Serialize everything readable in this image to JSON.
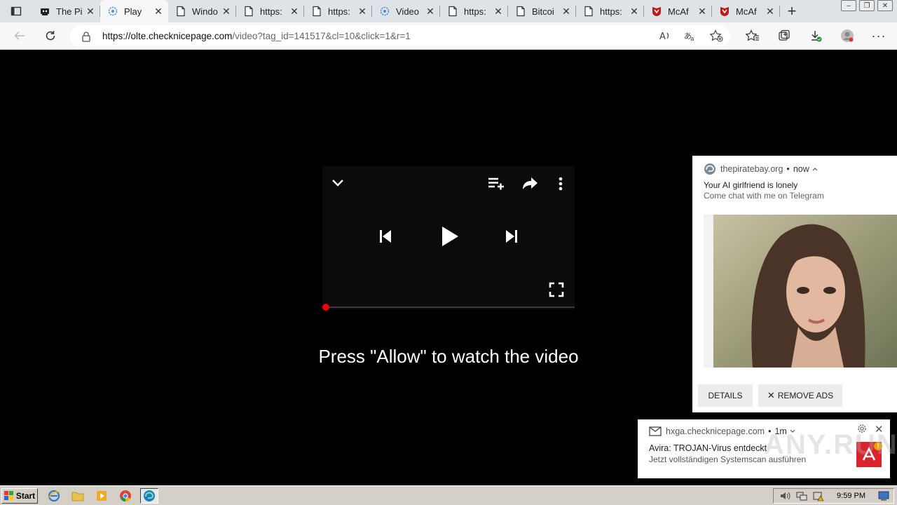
{
  "browser": {
    "tabs": [
      {
        "title": "The Pi",
        "icon": "robot-icon",
        "active": false
      },
      {
        "title": "Play",
        "icon": "gear-cloud-icon",
        "active": true
      },
      {
        "title": "Windo",
        "icon": "page-icon",
        "active": false
      },
      {
        "title": "https:",
        "icon": "page-icon",
        "active": false
      },
      {
        "title": "https:",
        "icon": "page-icon",
        "active": false
      },
      {
        "title": "Video",
        "icon": "gear-cloud-icon",
        "active": false
      },
      {
        "title": "https:",
        "icon": "page-icon",
        "active": false
      },
      {
        "title": "Bitcoi",
        "icon": "page-icon",
        "active": false
      },
      {
        "title": "https:",
        "icon": "page-icon",
        "active": false
      },
      {
        "title": "McAf",
        "icon": "mcafee-icon",
        "active": false
      },
      {
        "title": "McAf",
        "icon": "mcafee-icon",
        "active": false
      }
    ],
    "url_host": "https://olte.checknicepage.com",
    "url_path": "/video?tag_id=141517&cl=10&click=1&r=1"
  },
  "page": {
    "allow_text": "Press \"Allow\" to watch the video"
  },
  "notification1": {
    "source": "thepiratebay.org",
    "time": "now",
    "title": "Your AI girlfriend is lonely",
    "body": "Come chat with me on Telegram",
    "details_label": "DETAILS",
    "remove_ads_label": "REMOVE ADS"
  },
  "notification2": {
    "source": "hxga.checknicepage.com",
    "time": "1m",
    "title": "Avira: TROJAN-Virus entdeckt",
    "body": "Jetzt vollständigen Systemscan ausführen",
    "watermark": "ANY.RUN"
  },
  "taskbar": {
    "start_label": "Start",
    "clock": "9:59 PM"
  },
  "colors": {
    "progress_dot": "#e00000",
    "avira_red": "#d9232d",
    "mcafee_red": "#c01818"
  }
}
